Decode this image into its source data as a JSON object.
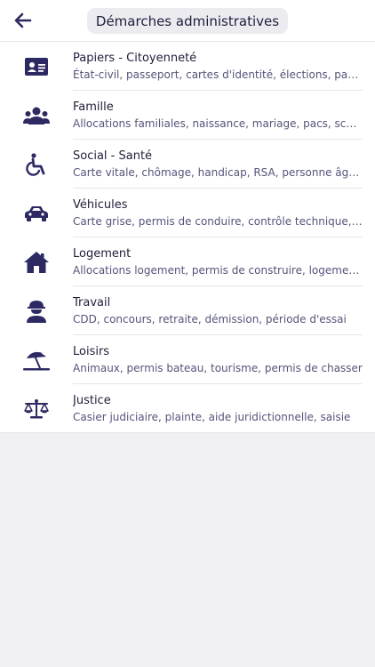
{
  "header": {
    "title": "Démarches administratives",
    "back_icon": "arrow-left-icon"
  },
  "colors": {
    "icon": "#2d2a63",
    "subtitle": "#54547a",
    "background": "#efeff4"
  },
  "items": [
    {
      "title": "Papiers - Citoyenneté",
      "subtitle": "État-civil, passeport, cartes d'identité, élections, papiers...",
      "icon": "id-card-icon"
    },
    {
      "title": "Famille",
      "subtitle": "Allocations familiales, naissance, mariage, pacs, scolarité...",
      "icon": "family-icon"
    },
    {
      "title": "Social - Santé",
      "subtitle": "Carte vitale, chômage, handicap, RSA, personne âgée...",
      "icon": "wheelchair-icon"
    },
    {
      "title": "Véhicules",
      "subtitle": "Carte grise, permis de conduire, contrôle technique, infractions...",
      "icon": "car-icon"
    },
    {
      "title": "Logement",
      "subtitle": "Allocations logement, permis de construire, logement social...",
      "icon": "house-icon"
    },
    {
      "title": "Travail",
      "subtitle": "CDD, concours, retraite, démission, période d'essai",
      "icon": "worker-icon"
    },
    {
      "title": "Loisirs",
      "subtitle": "Animaux, permis bateau, tourisme, permis de chasser",
      "icon": "beach-umbrella-icon"
    },
    {
      "title": "Justice",
      "subtitle": "Casier judiciaire, plainte, aide juridictionnelle, saisie",
      "icon": "scales-icon"
    }
  ]
}
